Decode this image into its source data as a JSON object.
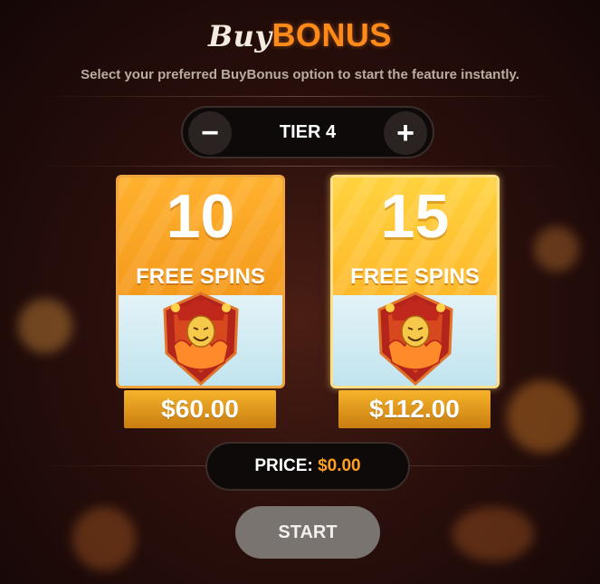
{
  "header": {
    "title_buy": "Buy",
    "title_bonus": "BONUS",
    "subtitle": "Select your preferred BuyBonus option to start the feature instantly."
  },
  "tier_selector": {
    "minus_label": "−",
    "label": "TIER 4",
    "plus_label": "+"
  },
  "options": [
    {
      "spins": "10",
      "label": "FREE SPINS",
      "price": "$60.00",
      "icon": "jester-badge-icon"
    },
    {
      "spins": "15",
      "label": "FREE SPINS",
      "price": "$112.00",
      "icon": "jester-badge-icon"
    }
  ],
  "price_bar": {
    "label": "PRICE:",
    "value": "$0.00"
  },
  "start_button": {
    "label": "START"
  },
  "colors": {
    "accent_orange": "#ff8a1a",
    "card_orange": "#f59a1c",
    "card_gold": "#ffd23e",
    "price_value": "#ff9f1a",
    "start_disabled": "#7a7471"
  }
}
